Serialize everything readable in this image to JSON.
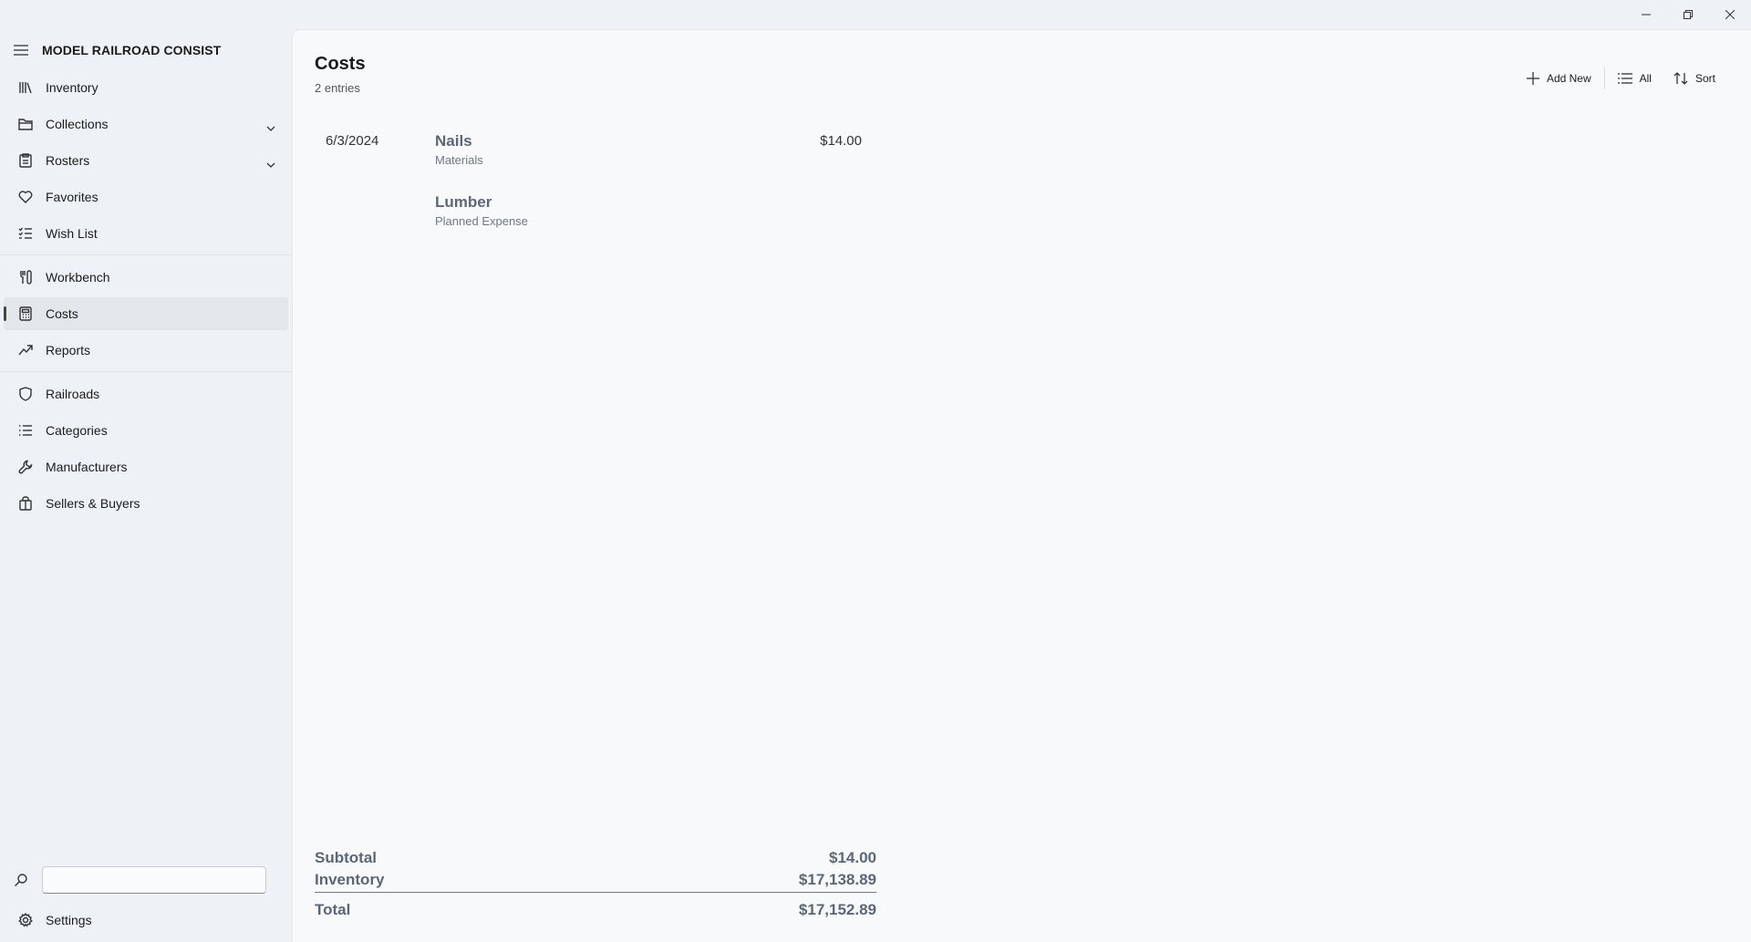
{
  "app": {
    "title": "MODEL RAILROAD CONSIST"
  },
  "sidebar": {
    "items": [
      {
        "label": "Inventory",
        "icon": "books-icon"
      },
      {
        "label": "Collections",
        "icon": "folder-icon",
        "expandable": true
      },
      {
        "label": "Rosters",
        "icon": "clipboard-icon",
        "expandable": true
      },
      {
        "label": "Favorites",
        "icon": "heart-icon"
      },
      {
        "label": "Wish List",
        "icon": "checklist-icon"
      },
      {
        "label": "Workbench",
        "icon": "tools-icon"
      },
      {
        "label": "Costs",
        "icon": "calculator-icon",
        "selected": true
      },
      {
        "label": "Reports",
        "icon": "trend-icon"
      },
      {
        "label": "Railroads",
        "icon": "shield-icon"
      },
      {
        "label": "Categories",
        "icon": "list-icon"
      },
      {
        "label": "Manufacturers",
        "icon": "wrench-icon"
      },
      {
        "label": "Sellers & Buyers",
        "icon": "shopping-bag-icon"
      }
    ],
    "search": {
      "placeholder": ""
    },
    "settings_label": "Settings"
  },
  "main": {
    "title": "Costs",
    "subtitle": "2 entries",
    "toolbar": {
      "add_new": "Add New",
      "filter": "All",
      "sort": "Sort"
    },
    "entries": [
      {
        "date": "6/3/2024",
        "name": "Nails",
        "category": "Materials",
        "amount": "$14.00"
      },
      {
        "date": "",
        "name": "Lumber",
        "category": "Planned Expense",
        "amount": ""
      }
    ],
    "totals": {
      "subtotal_label": "Subtotal",
      "subtotal": "$14.00",
      "inventory_label": "Inventory",
      "inventory": "$17,138.89",
      "total_label": "Total",
      "total": "$17,152.89"
    }
  },
  "colors": {
    "accent_text": "#5b6677",
    "background": "#eef1f5",
    "content": "#f8f9fb"
  }
}
